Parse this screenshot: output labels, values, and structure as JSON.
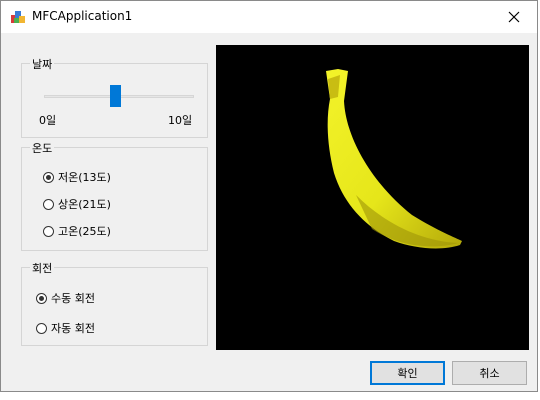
{
  "window": {
    "title": "MFCApplication1",
    "icons": {
      "app": "mfc-app-icon",
      "close": "close-icon"
    }
  },
  "groups": {
    "date": {
      "label": "날짜",
      "slider": {
        "min_label": "0일",
        "max_label": "10일",
        "value": 5,
        "min": 0,
        "max": 10
      }
    },
    "temperature": {
      "label": "온도",
      "options": [
        {
          "label": "저온(13도)",
          "checked": true
        },
        {
          "label": "상온(21도)",
          "checked": false
        },
        {
          "label": "고온(25도)",
          "checked": false
        }
      ]
    },
    "rotation": {
      "label": "회전",
      "options": [
        {
          "label": "수동 회전",
          "checked": true
        },
        {
          "label": "자동 회전",
          "checked": false
        }
      ]
    }
  },
  "viewport": {
    "background": "#000000",
    "object": "banana",
    "object_color": "#e8e81c"
  },
  "buttons": {
    "ok": "확인",
    "cancel": "취소"
  },
  "colors": {
    "accent": "#0078d7",
    "dialog_bg": "#f0f0f0"
  }
}
